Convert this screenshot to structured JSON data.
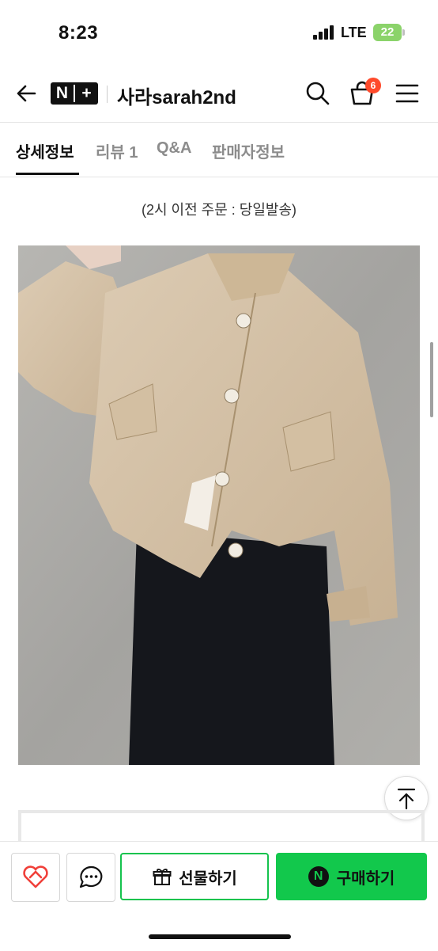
{
  "status_bar": {
    "time": "8:23",
    "network": "LTE",
    "battery": "22"
  },
  "header": {
    "brand_left": "N",
    "brand_right": "+",
    "shop_name": "사라sarah2nd",
    "cart_count": "6",
    "icons": [
      "back-arrow-icon",
      "search-icon",
      "cart-icon",
      "menu-icon"
    ]
  },
  "tabs": [
    {
      "label": "상세정보",
      "active": true
    },
    {
      "label": "리뷰 1",
      "active": false
    },
    {
      "label": "Q&A",
      "active": false
    },
    {
      "label": "판매자정보",
      "active": false
    }
  ],
  "notice": "(2시 이전 주문 : 당일발송)",
  "actions": {
    "gift_label": "선물하기",
    "buy_label": "구매하기",
    "buy_icon_letter": "N"
  },
  "colors": {
    "accent_green": "#12c84c",
    "badge_red": "#ff4a2b",
    "wishlist_red": "#f0403a"
  }
}
